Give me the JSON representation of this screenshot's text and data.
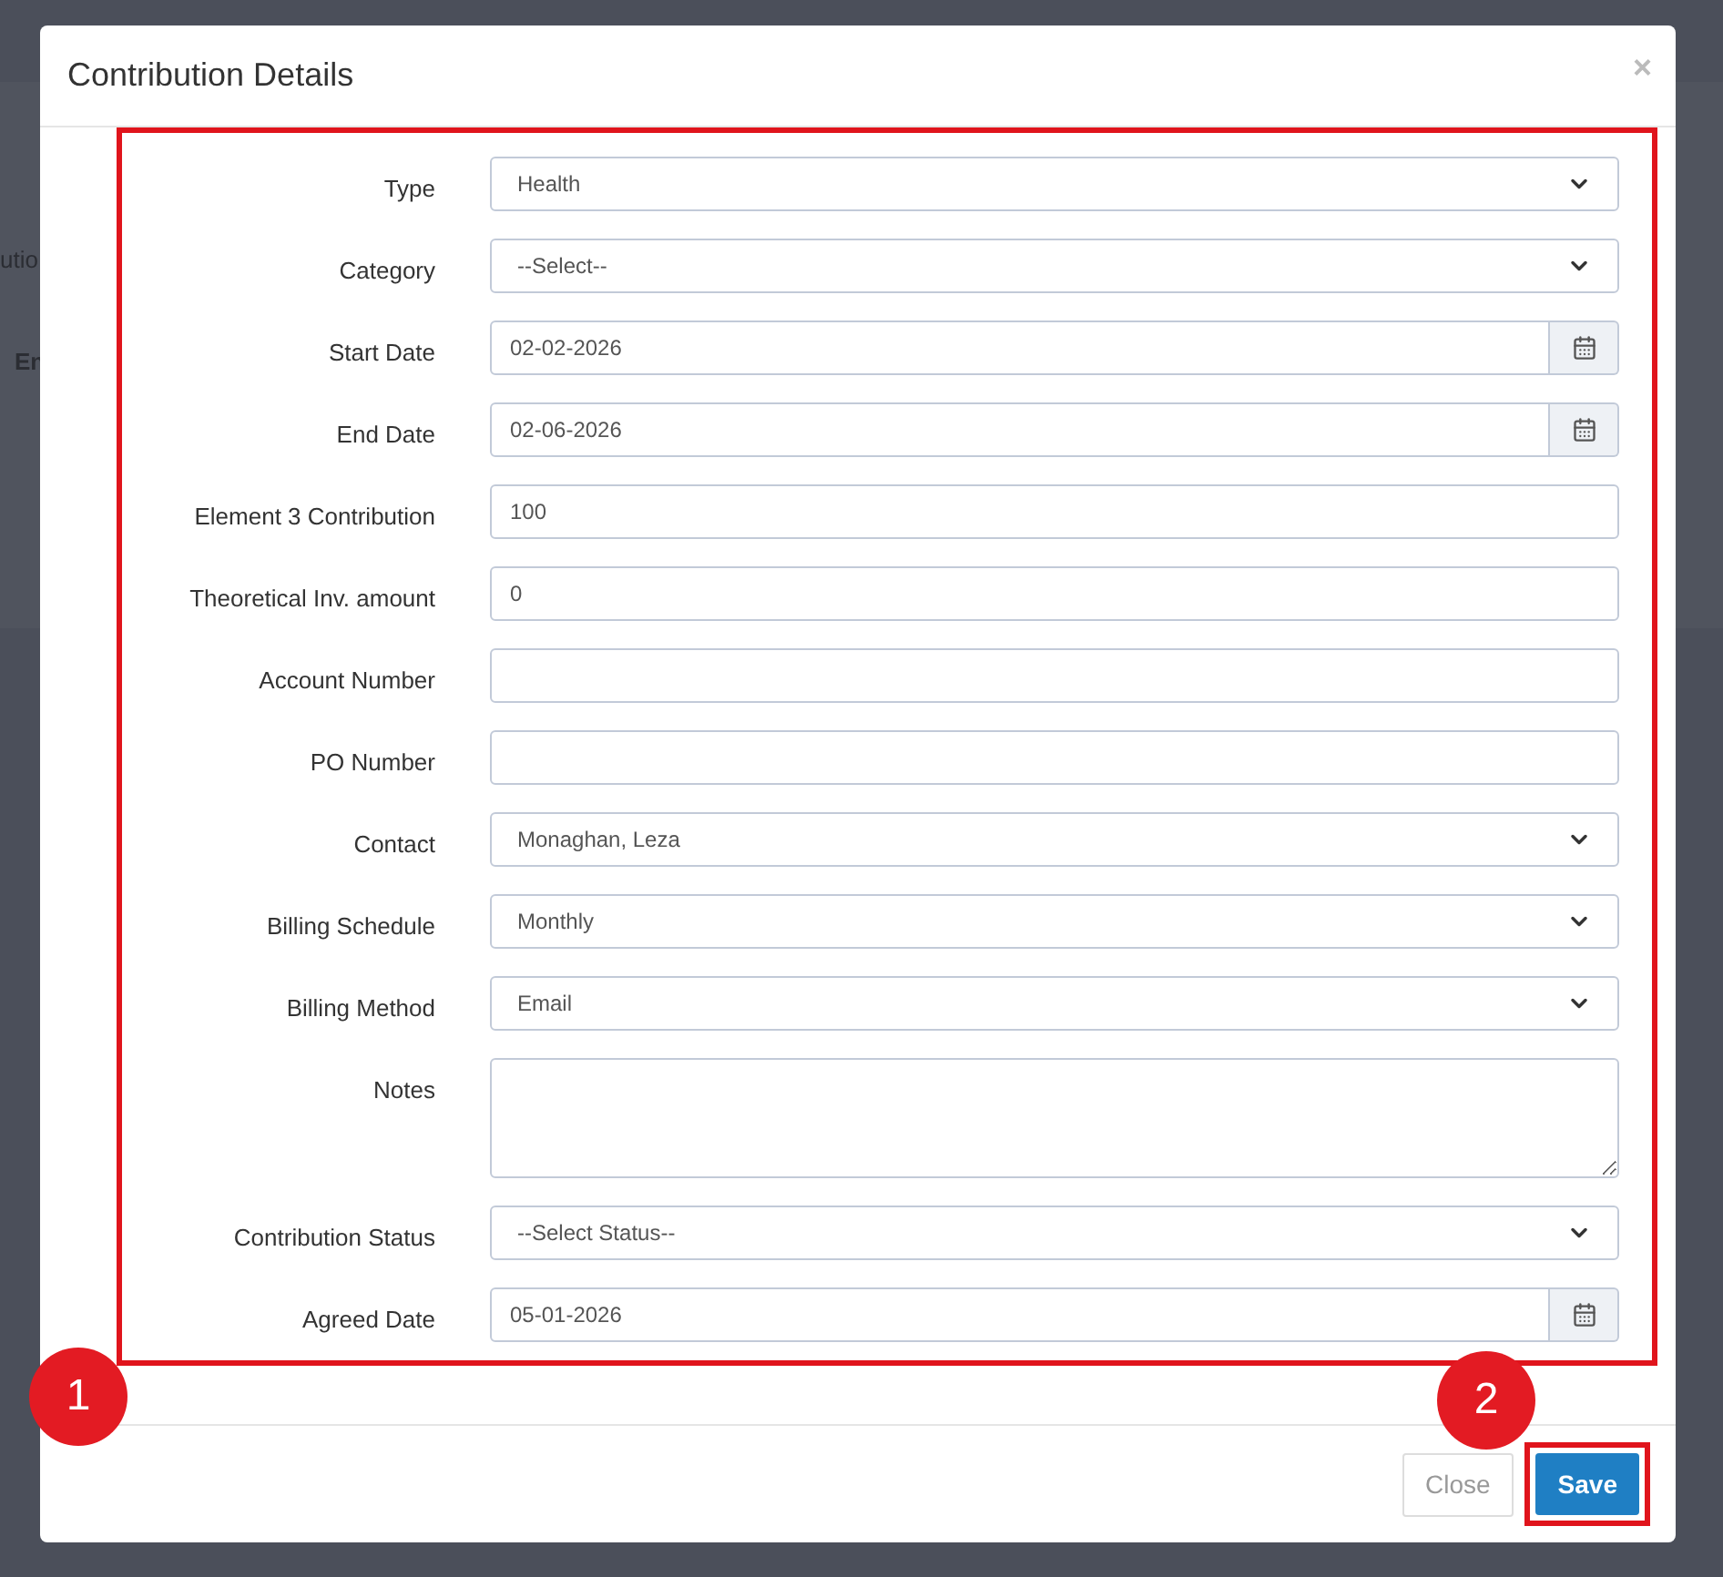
{
  "background_page": {
    "texts": [
      "utio",
      "En"
    ]
  },
  "modal": {
    "title": "Contribution Details",
    "close_icon": "×",
    "fields": [
      {
        "label": "Type",
        "kind": "select",
        "value": "Health"
      },
      {
        "label": "Category",
        "kind": "select",
        "value": "--Select--"
      },
      {
        "label": "Start Date",
        "kind": "date",
        "value": "02-02-2026"
      },
      {
        "label": "End Date",
        "kind": "date",
        "value": "02-06-2026"
      },
      {
        "label": "Element 3 Contribution",
        "kind": "text",
        "value": "100"
      },
      {
        "label": "Theoretical Inv. amount",
        "kind": "text",
        "value": "0"
      },
      {
        "label": "Account Number",
        "kind": "text"
      },
      {
        "label": "PO Number",
        "kind": "text"
      },
      {
        "label": "Contact",
        "kind": "select",
        "value": "Monaghan, Leza"
      },
      {
        "label": "Billing Schedule",
        "kind": "select",
        "value": "Monthly"
      },
      {
        "label": "Billing Method",
        "kind": "select",
        "value": "Email"
      },
      {
        "label": "Notes",
        "kind": "textarea"
      },
      {
        "label": "Contribution Status",
        "kind": "select",
        "value": "--Select Status--"
      },
      {
        "label": "Agreed Date",
        "kind": "date",
        "value": "05-01-2026"
      }
    ],
    "buttons": [
      {
        "label": "Close",
        "kind": "default"
      },
      {
        "label": "Save",
        "kind": "primary"
      }
    ]
  },
  "annotations": [
    "1",
    "2"
  ]
}
